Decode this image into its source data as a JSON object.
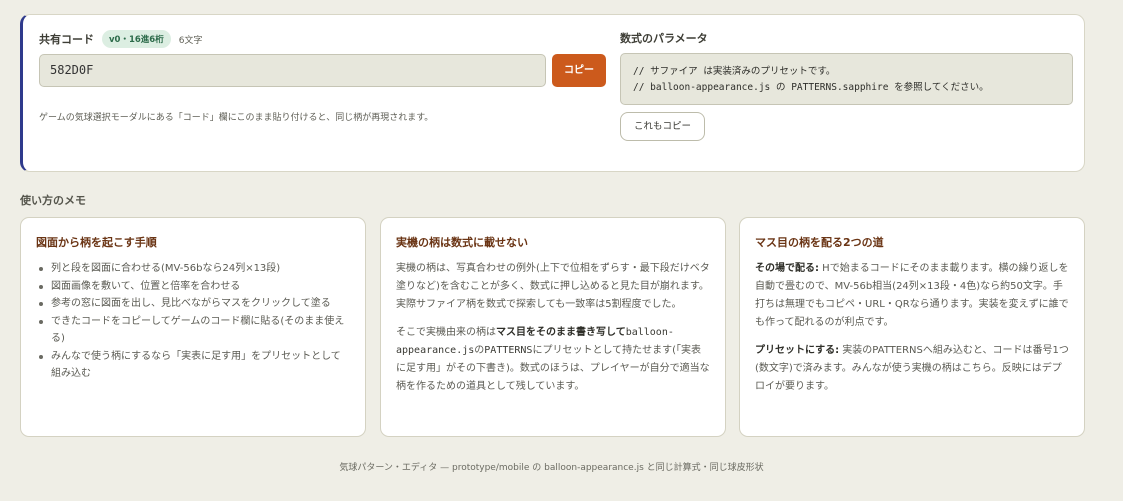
{
  "share": {
    "label": "共有コード",
    "badge": "v0・16進6桁",
    "char_count": "6文字",
    "code_value": "582D0F",
    "copy_label": "コピー",
    "hint": "ゲームの気球選択モーダルにある「コード」欄にこのまま貼り付けると、同じ柄が再現されます。"
  },
  "params": {
    "label": "数式のパラメータ",
    "line1": "// サファイア は実装済みのプリセットです。",
    "line2": "// balloon-appearance.js の PATTERNS.sapphire を参照してください。",
    "copy_label": "これもコピー"
  },
  "memo": {
    "heading": "使い方のメモ",
    "card1": {
      "title": "図面から柄を起こす手順",
      "items": [
        "列と段を図面に合わせる(MV-56bなら24列×13段)",
        "図面画像を敷いて、位置と倍率を合わせる",
        "参考の窓に図面を出し、見比べながらマスをクリックして塗る",
        "できたコードをコピーしてゲームのコード欄に貼る(そのまま使える)",
        "みんなで使う柄にするなら「実表に足す用」をプリセットとして組み込む"
      ]
    },
    "card2": {
      "title": "実機の柄は数式に載せない",
      "p1": "実機の柄は、写真合わせの例外(上下で位相をずらす・最下段だけベタ塗りなど)を含むことが多く、数式に押し込めると見た目が崩れます。実際サファイア柄を数式で探索しても一致率は5割程度でした。",
      "p2_a": "そこで実機由来の柄は",
      "p2_bold": "マス目をそのまま書き写して",
      "p2_mono1": "balloon-appearance.js",
      "p2_b": "の",
      "p2_mono2": "PATTERNS",
      "p2_c": "にプリセットとして持たせます(「実表に足す用」がその下書き)。数式のほうは、プレイヤーが自分で適当な柄を作るための道具として残しています。"
    },
    "card3": {
      "title": "マス目の柄を配る2つの道",
      "p1_bold": "その場で配る:",
      "p1_text": " Hで始まるコードにそのまま載ります。横の繰り返しを自動で畳むので、MV-56b相当(24列×13段・4色)なら約50文字。手打ちは無理でもコピペ・URL・QRなら通ります。実装を変えずに誰でも作って配れるのが利点です。",
      "p2_bold": "プリセットにする:",
      "p2_text": " 実装のPATTERNSへ組み込むと、コードは番号1つ(数文字)で済みます。みんなが使う実機の柄はこちら。反映にはデプロイが要ります。"
    }
  },
  "footer": "気球パターン・エディタ — prototype/mobile の balloon-appearance.js と同じ計算式・同じ球皮形状"
}
